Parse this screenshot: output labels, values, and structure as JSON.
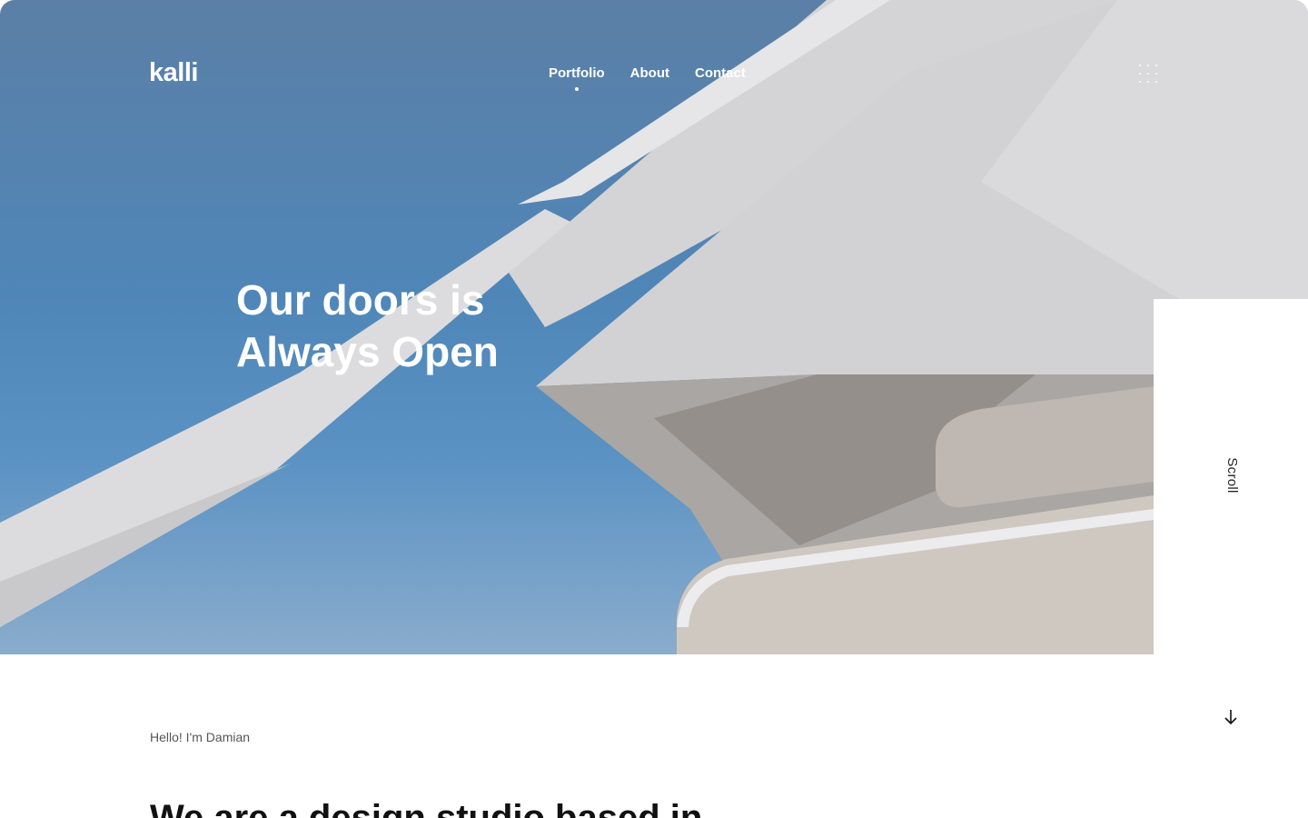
{
  "header": {
    "logo": "kalli",
    "nav": [
      {
        "label": "Portfolio",
        "active": true
      },
      {
        "label": "About",
        "active": false
      },
      {
        "label": "Contact",
        "active": false
      }
    ],
    "menu_icon": "grid-dots-icon"
  },
  "hero": {
    "headline_line1": "Our doors is",
    "headline_line2": "Always Open",
    "sky_color": "#4f86b8",
    "structure_color": "#d6d6d8"
  },
  "side": {
    "scroll_label": "Scroll",
    "arrow_icon": "arrow-down-icon"
  },
  "intro": {
    "greeting": "Hello! I'm Damian",
    "heading": "We are a design studio based in"
  }
}
